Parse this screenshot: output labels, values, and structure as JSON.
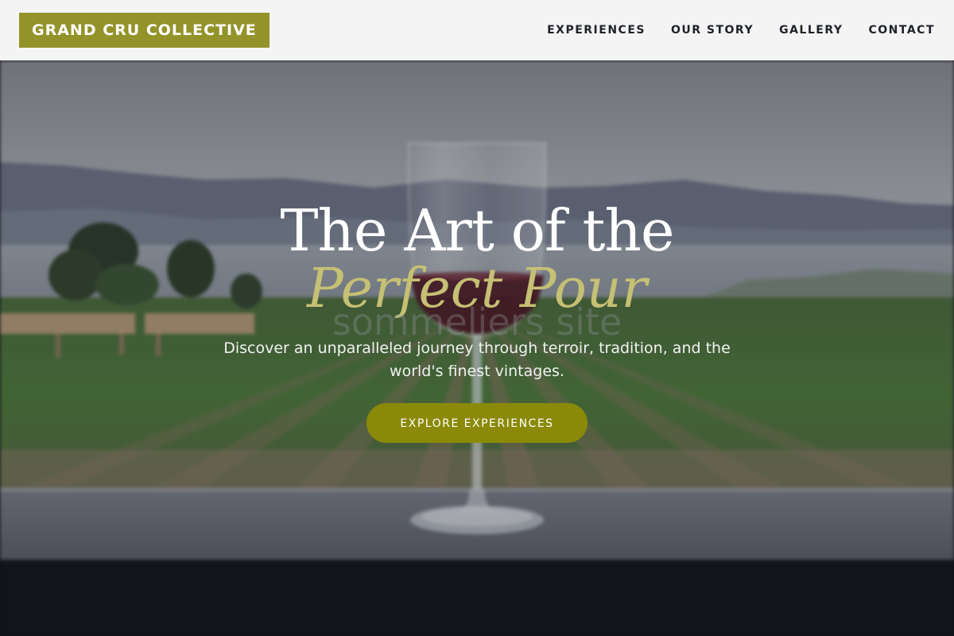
{
  "header": {
    "logo_text": "GRAND CRU COLLECTIVE",
    "nav": [
      {
        "label": "EXPERIENCES"
      },
      {
        "label": "OUR STORY"
      },
      {
        "label": "GALLERY"
      },
      {
        "label": "CONTACT"
      }
    ]
  },
  "hero": {
    "title_line1": "The Art of the",
    "title_line2": "Perfect Pour",
    "watermark": "sommeliers site",
    "subtitle": "Discover an unparalleled journey through terroir, tradition, and the world's finest vintages.",
    "cta_label": "EXPLORE EXPERIENCES",
    "background_image": "vineyard-with-wine-glass"
  },
  "colors": {
    "header_bg": "#f4f4f4",
    "logo_bg": "#94932a",
    "nav_text": "#1e2228",
    "title_white": "#ffffff",
    "title_accent": "#c6c074",
    "cta_bg": "#8a8a08"
  }
}
